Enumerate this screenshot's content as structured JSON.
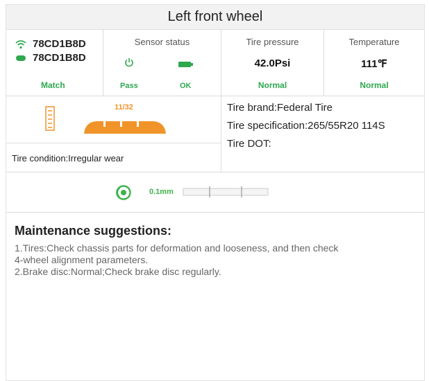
{
  "header": {
    "title": "Left front wheel"
  },
  "sensor_ids": [
    {
      "id": "78CD1B8D",
      "icon": "wifi-icon"
    },
    {
      "id": "78CD1B8D",
      "icon": "sensor-capsule-icon"
    }
  ],
  "match_label": "Match",
  "sensor_status": {
    "label": "Sensor status",
    "power_status": "Pass",
    "battery_status": "OK"
  },
  "tire_pressure": {
    "label": "Tire pressure",
    "value": "42.0Psi",
    "status": "Normal"
  },
  "temperature": {
    "label": "Temperature",
    "value": "111℉",
    "status": "Normal"
  },
  "tread": {
    "depth_label": "11/32"
  },
  "tire_condition": "Tire condition:Irregular wear",
  "tire_info": {
    "brand": "Tire brand:Federal Tire",
    "specification": "Tire specification:265/55R20 114S",
    "dot": "Tire DOT:"
  },
  "brake": {
    "value": "0.1mm"
  },
  "maintenance": {
    "title": "Maintenance suggestions:",
    "lines": [
      "1.Tires:Check chassis parts for deformation and looseness, and then check",
      "4-wheel alignment parameters.",
      "2.Brake disc:Normal;Check brake disc regularly."
    ]
  },
  "colors": {
    "green": "#2fa84f",
    "orange": "#f0942a",
    "brake_green": "#3cb34a"
  }
}
